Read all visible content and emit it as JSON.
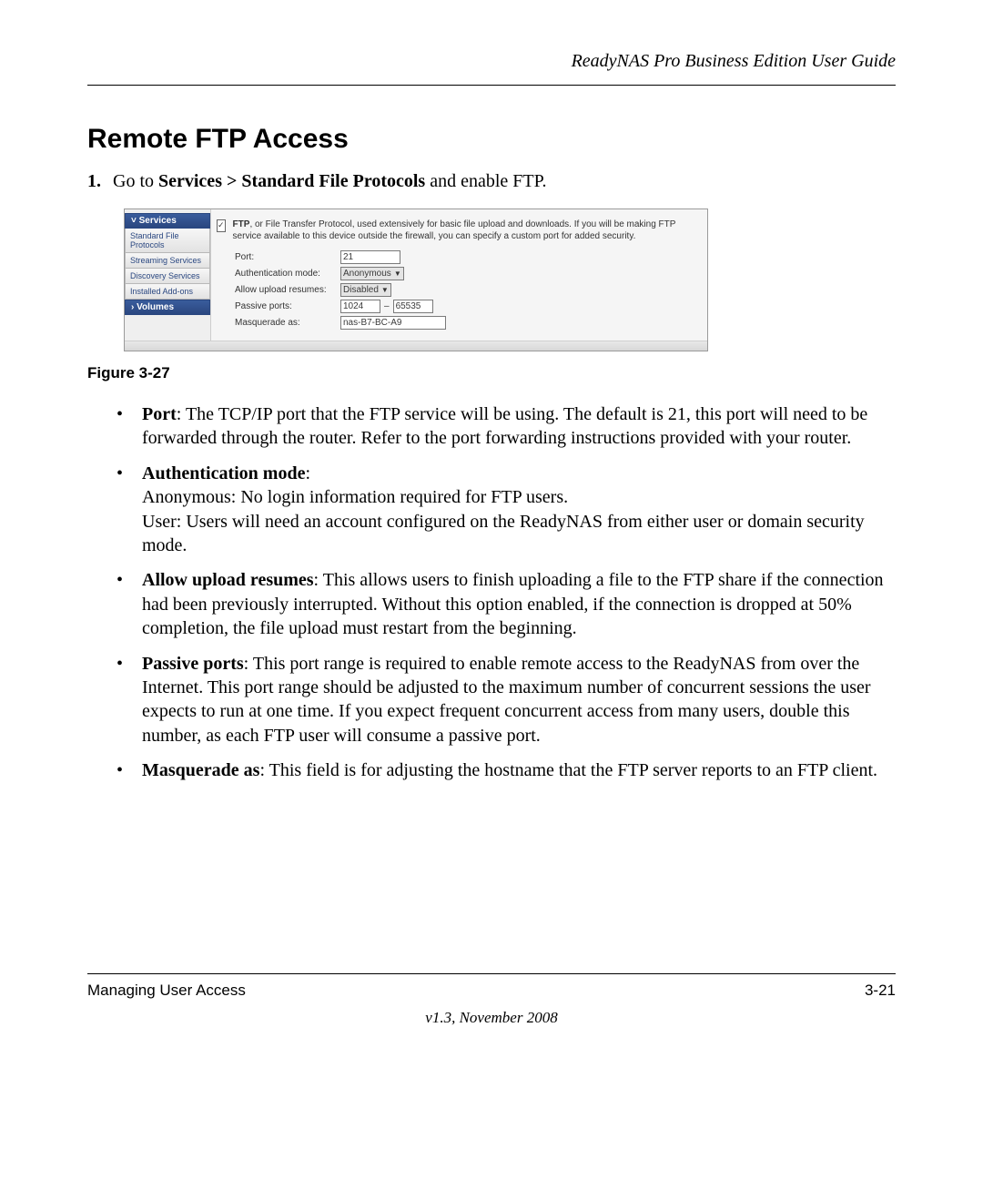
{
  "header": {
    "running_head": "ReadyNAS Pro Business Edition User Guide"
  },
  "title": "Remote FTP Access",
  "step1": {
    "num": "1.",
    "pre": "Go to ",
    "bold": "Services > Standard File Protocols",
    "post": " and enable FTP."
  },
  "screenshot": {
    "nav": {
      "services_hdr": "Services",
      "items": [
        "Standard File Protocols",
        "Streaming Services",
        "Discovery Services",
        "Installed Add-ons"
      ],
      "volumes_hdr": "Volumes"
    },
    "desc_bold": "FTP",
    "desc_rest": ", or File Transfer Protocol, used extensively for basic file upload and downloads. If you will be making FTP service available to this device outside the firewall, you can specify a custom port for added security.",
    "fields": {
      "port_label": "Port:",
      "port_value": "21",
      "auth_label": "Authentication mode:",
      "auth_value": "Anonymous",
      "resume_label": "Allow upload resumes:",
      "resume_value": "Disabled",
      "passive_label": "Passive ports:",
      "passive_from": "1024",
      "passive_dash": "–",
      "passive_to": "65535",
      "masq_label": "Masquerade as:",
      "masq_value": "nas-B7-BC-A9"
    }
  },
  "figure_caption": "Figure 3-27",
  "bullets": {
    "port": {
      "label": "Port",
      "text": ": The TCP/IP port that the FTP service will be using. The default is 21, this port will need to be forwarded through the router. Refer to the port forwarding instructions provided with your router."
    },
    "auth": {
      "label": "Authentication mode",
      "colon": ":",
      "line1": "Anonymous: No login information required for FTP users.",
      "line2": "User: Users will need an account configured on the ReadyNAS from either user or domain security mode."
    },
    "resume": {
      "label": "Allow upload resumes",
      "text": ": This allows users to finish uploading a file to the FTP share if the connection had been previously interrupted. Without this option enabled, if the connection is dropped at 50% completion, the file upload must restart from the beginning."
    },
    "passive": {
      "label": "Passive ports",
      "text": ": This port range is required to enable remote access to the ReadyNAS from over the Internet. This port range should be adjusted to the maximum number of concurrent sessions the user expects to run at one time. If you expect frequent concurrent access from many users, double this number, as each FTP user will consume a passive port."
    },
    "masq": {
      "label": "Masquerade as",
      "text": ": This field is for adjusting the hostname that the FTP server reports to an FTP client."
    }
  },
  "footer": {
    "section": "Managing User Access",
    "page": "3-21",
    "version": "v1.3, November 2008"
  }
}
